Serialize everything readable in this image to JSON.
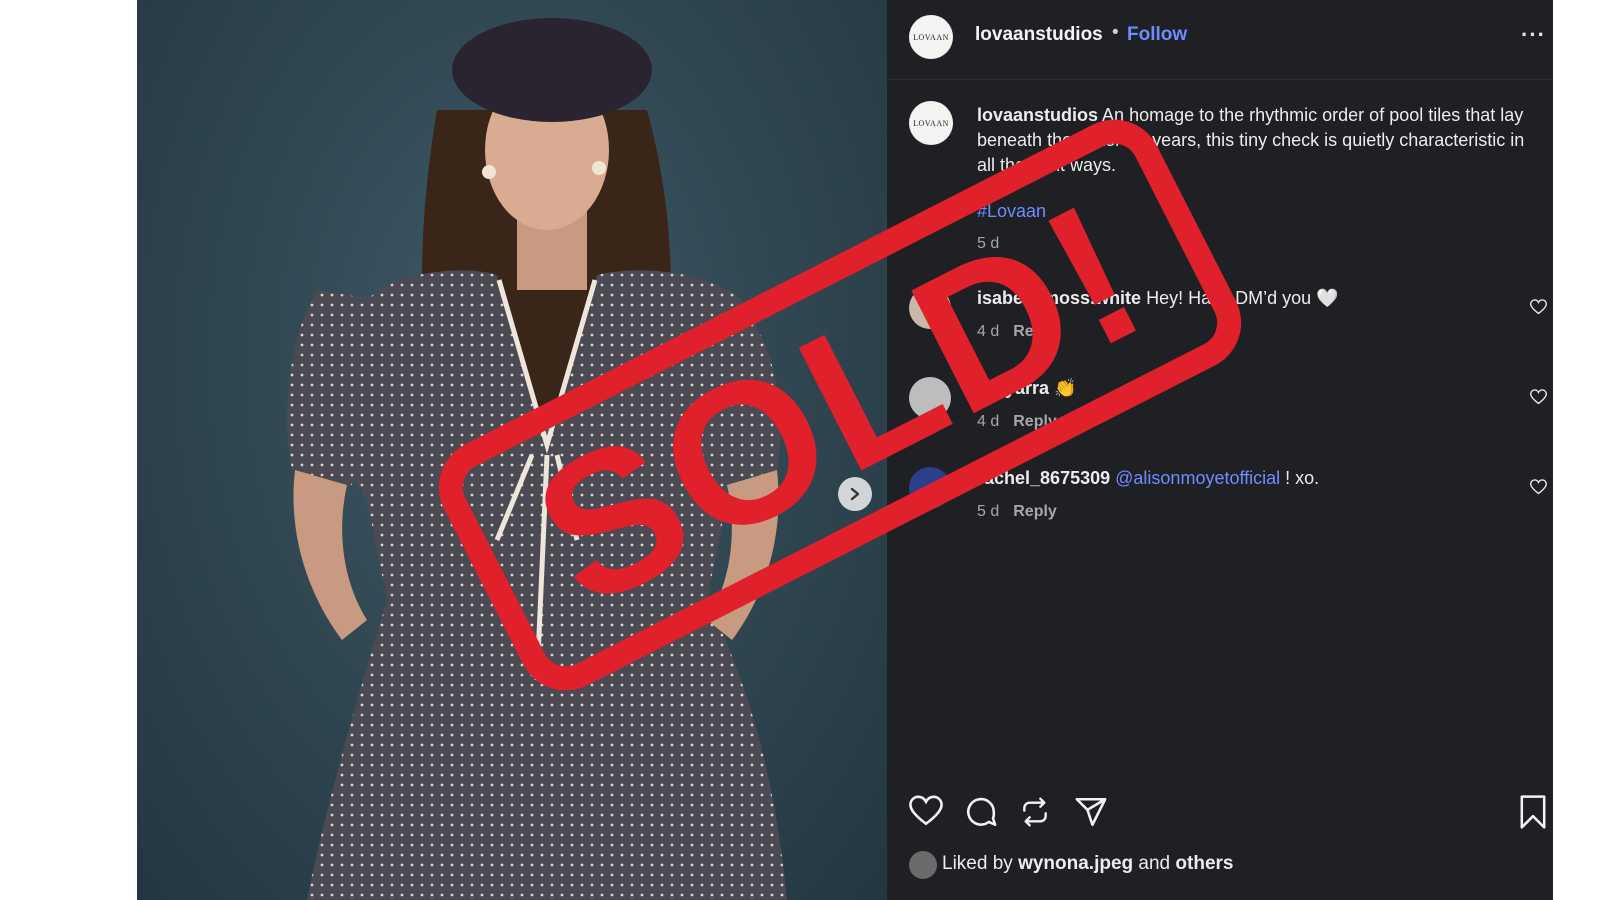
{
  "post": {
    "username": "lovaanstudios",
    "avatar_text": "LOVAAN",
    "separator": "•",
    "follow_label": "Follow",
    "more_label": "···",
    "caption_user": "lovaanstudios",
    "caption_text": "An homage to the rhythmic order of pool tiles that lay beneath the water for years, this tiny check is quietly characteristic in all the right ways.",
    "hashtag": "#Lovaan",
    "caption_age": "5 d"
  },
  "comments": [
    {
      "user": "isabellamoss.white",
      "text": "Hey! Have DM’d you 🤍",
      "age": "4 d",
      "reply_label": "Reply"
    },
    {
      "user": "bryyarra",
      "text": "👏",
      "age": "4 d",
      "reply_label": "Reply"
    },
    {
      "user": "rachel_8675309",
      "mention": "@alisonmoyetofficial",
      "text": "! xo.",
      "age": "5 d",
      "reply_label": "Reply"
    }
  ],
  "actions": [
    "heart-icon",
    "comment-icon",
    "repost-icon",
    "share-icon",
    "bookmark-icon"
  ],
  "likes": {
    "prefix": "Liked by",
    "user": "wynona.jpeg",
    "conj": "and",
    "others": "others"
  },
  "stamp": {
    "text": "SOLD!",
    "color": "#e0202b"
  },
  "colors": {
    "panel_bg": "#1f2024",
    "link": "#6f8cff",
    "photo_bg": "#2f4550"
  }
}
